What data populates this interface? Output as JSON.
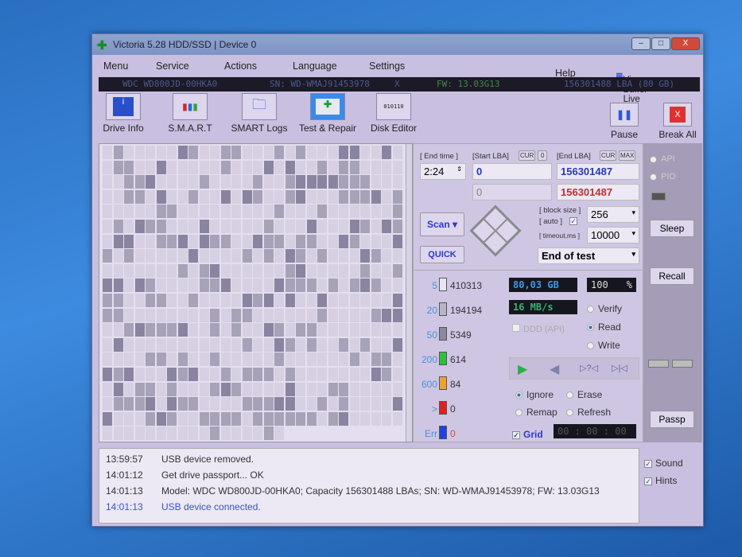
{
  "window": {
    "title": "Victoria 5.28 HDD/SSD | Device 0",
    "minimize": "–",
    "maximize": "□",
    "close": "X"
  },
  "menu": [
    "Menu",
    "Service",
    "Actions",
    "Language",
    "Settings"
  ],
  "help": "Help",
  "view_buffer": "View Buffer Live",
  "infobar": {
    "model": "WDC WD800JD-00HKA0",
    "sn": "SN: WD-WMAJ91453978",
    "x": "X",
    "fw": "FW: 13.03G13",
    "lba": "156301488 LBA (80 GB)"
  },
  "toolbar": {
    "drive_info": "Drive Info",
    "smart": "S.M.A.R.T",
    "smart_logs": "SMART Logs",
    "test_repair": "Test & Repair",
    "disk_editor": "Disk Editor",
    "disk_editor_icon_text": "010110",
    "pause": "Pause",
    "break_all": "Break All"
  },
  "scan": {
    "end_time_label": "[ End time ]",
    "start_lba_label": "[Start LBA]",
    "cur": "CUR",
    "zero": "0",
    "end_lba_label": "[End LBA]",
    "max": "MAX",
    "end_time": "2:24",
    "start_lba": "0",
    "end_lba": "156301487",
    "start_lba2": "0",
    "end_lba2": "156301487",
    "scan_button": "Scan",
    "quick_button": "QUICK",
    "block_size_label": "[ block size ]",
    "auto_label": "[ auto ]",
    "block_size": "256",
    "timeout_label": "[ timeout,ms ]",
    "timeout": "10000",
    "end_action": "End of test"
  },
  "stats": [
    {
      "label": "5",
      "count": "410313",
      "color": "#e8e4f0"
    },
    {
      "label": "20",
      "count": "194194",
      "color": "#b8b4c8"
    },
    {
      "label": "50",
      "count": "5349",
      "color": "#8c88a0"
    },
    {
      "label": "200",
      "count": "614",
      "color": "#30c040"
    },
    {
      "label": "600",
      "count": "84",
      "color": "#f0a030"
    },
    {
      "label": ">",
      "count": "0",
      "color": "#e02020"
    },
    {
      "label": "Err",
      "count": "0",
      "color": "#2040e0"
    }
  ],
  "progress": {
    "size": "80,03 GB",
    "percent": "100",
    "percent_sign": "%",
    "speed": "16 MB/s",
    "ddd": "DDD (API)"
  },
  "modes": {
    "verify": "Verify",
    "read": "Read",
    "write": "Write"
  },
  "playback": {
    "play": "▶",
    "back": "◀",
    "pause_skip": "▷?◁",
    "end": "▷|◁"
  },
  "repair": {
    "ignore": "Ignore",
    "erase": "Erase",
    "remap": "Remap",
    "refresh": "Refresh"
  },
  "grid_label": "Grid",
  "timer": "00 : 00 : 00",
  "right": {
    "api": "API",
    "pio": "PIO",
    "sleep": "Sleep",
    "recall": "Recall",
    "passp": "Passp"
  },
  "log": [
    {
      "time": "13:59:57",
      "msg": "USB device removed.",
      "color": "#333"
    },
    {
      "time": "14:01:12",
      "msg": "Get drive passport... OK",
      "color": "#333"
    },
    {
      "time": "14:01:13",
      "msg": "Model: WDC WD800JD-00HKA0; Capacity 156301488 LBAs; SN: WD-WMAJ91453978; FW: 13.03G13",
      "color": "#333"
    },
    {
      "time": "14:01:13",
      "msg": "USB device connected.",
      "color": "#3a50d8"
    }
  ],
  "options": {
    "sound": "Sound",
    "hints": "Hints"
  }
}
